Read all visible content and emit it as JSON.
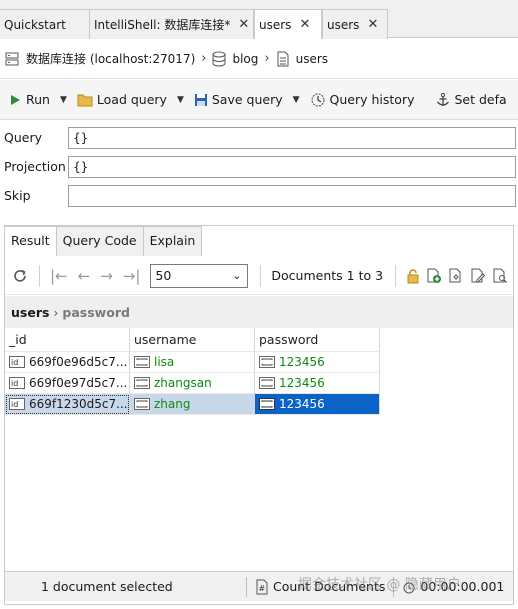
{
  "tabs": [
    {
      "label": "Quickstart",
      "closable": false
    },
    {
      "label": "IntelliShell: 数据库连接*",
      "closable": true
    },
    {
      "label": "users",
      "closable": true,
      "active": true
    },
    {
      "label": "users",
      "closable": true
    }
  ],
  "breadcrumb": {
    "connection": "数据库连接 (localhost:27017)",
    "database": "blog",
    "collection": "users"
  },
  "toolbar": {
    "run": "Run",
    "load_query": "Load query",
    "save_query": "Save query",
    "query_history": "Query history",
    "set_default": "Set defa"
  },
  "query": {
    "query_label": "Query",
    "query_value": "{}",
    "projection_label": "Projection",
    "projection_value": "{}",
    "skip_label": "Skip",
    "skip_value": ""
  },
  "result_tabs": [
    "Result",
    "Query Code",
    "Explain"
  ],
  "nav": {
    "page_size": "50",
    "documents_range": "Documents 1 to 3"
  },
  "path": {
    "collection": "users",
    "field": "password"
  },
  "table": {
    "columns": [
      "_id",
      "username",
      "password"
    ],
    "rows": [
      {
        "id": "669f0e96d5c7...",
        "username": "lisa",
        "password": "123456",
        "selected": false
      },
      {
        "id": "669f0e97d5c7...",
        "username": "zhangsan",
        "password": "123456",
        "selected": false
      },
      {
        "id": "669f1230d5c7...",
        "username": "zhang",
        "password": "123456",
        "selected": true
      }
    ]
  },
  "status": {
    "selection": "1 document selected",
    "count": "Count Documents",
    "timing": "00:00:00.001",
    "watermark": "掘金技术社区 @ 隐藏用户"
  },
  "colors": {
    "accent": "#0a64c8",
    "value_green": "#0d8a0d",
    "folder_yellow": "#e8b84a"
  }
}
